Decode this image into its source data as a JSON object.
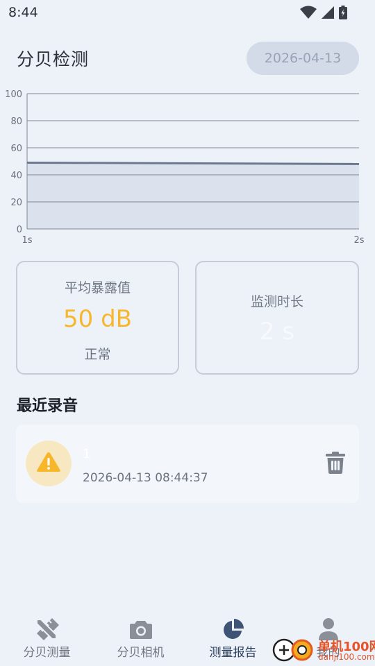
{
  "status_bar": {
    "time": "8:44"
  },
  "header": {
    "title": "分贝检测",
    "date": "2026-04-13"
  },
  "chart_data": {
    "type": "area",
    "x": [
      "1s",
      "2s"
    ],
    "series": [
      {
        "values": [
          49,
          48
        ]
      }
    ],
    "y_ticks": [
      "0",
      "20",
      "40",
      "60",
      "80",
      "100"
    ],
    "x_ticks": [
      "1s",
      "2s"
    ],
    "ylim": [
      0,
      100
    ],
    "grid": true,
    "line_color": "#6b7890",
    "fill_color": "#dbe2ed"
  },
  "stats": {
    "exposure_label": "平均暴露值",
    "exposure_value": "50 dB",
    "exposure_status": "正常",
    "duration_label": "监测时长",
    "duration_value": "2 s"
  },
  "recent": {
    "title": "最近录音",
    "items": [
      {
        "name": "1",
        "time": "2026-04-13 08:44:37",
        "icon": "warning-icon"
      }
    ]
  },
  "nav": [
    {
      "label": "分贝测量",
      "icon": "pencil-ruler-icon"
    },
    {
      "label": "分贝相机",
      "icon": "camera-icon"
    },
    {
      "label": "测量报告",
      "icon": "pie-chart-icon",
      "active": true
    },
    {
      "label": "我的",
      "icon": "person-icon"
    }
  ],
  "watermark": {
    "title": "单机100网",
    "url": "danji100.com"
  },
  "colors": {
    "accent": "#f8b72a",
    "background": "#edf2f9",
    "active_nav": "#3f5475"
  }
}
